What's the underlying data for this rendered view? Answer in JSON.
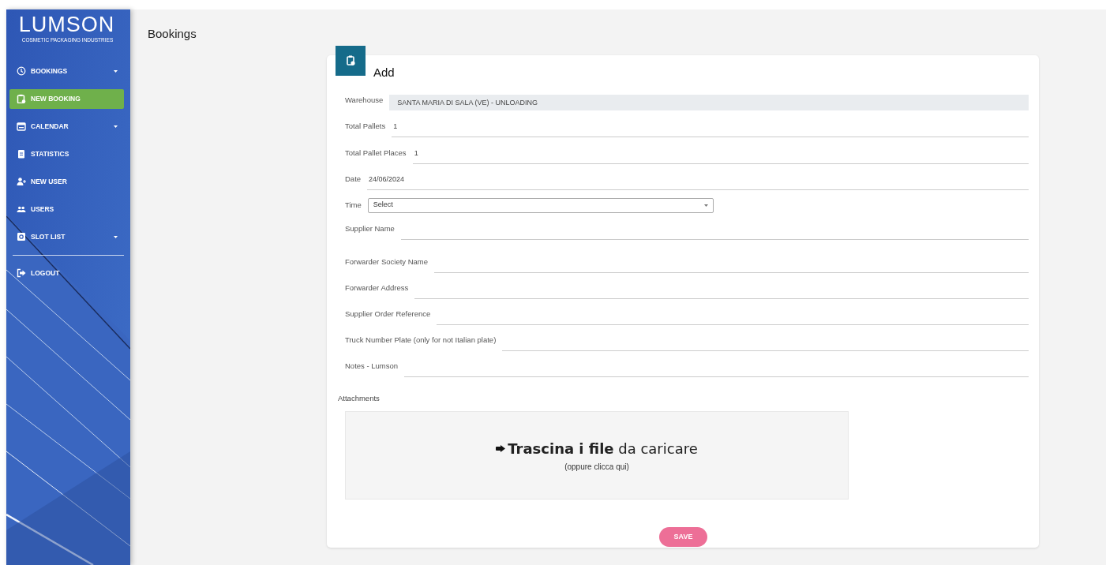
{
  "logo": {
    "name": "LUMSON",
    "tagline": "COSMETIC PACKAGING INDUSTRIES"
  },
  "sidebar": {
    "items": [
      {
        "label": "BOOKINGS",
        "selected": false,
        "expandable": true
      },
      {
        "label": "NEW BOOKING",
        "selected": true,
        "expandable": false
      },
      {
        "label": "CALENDAR",
        "selected": false,
        "expandable": true
      },
      {
        "label": "STATISTICS",
        "selected": false,
        "expandable": false
      },
      {
        "label": "NEW USER",
        "selected": false,
        "expandable": false
      },
      {
        "label": "USERS",
        "selected": false,
        "expandable": false
      },
      {
        "label": "SLOT LIST",
        "selected": false,
        "expandable": true
      }
    ],
    "footer_items": [
      {
        "label": "LOGOUT",
        "selected": false,
        "expandable": false
      }
    ]
  },
  "page_title": "Bookings",
  "form": {
    "title": "Add",
    "fields": [
      {
        "kind": "readonly",
        "label": "Warehouse",
        "value": "SANTA MARIA DI SALA (VE) - UNLOADING"
      },
      {
        "kind": "text",
        "label": "Total Pallets",
        "value": "1"
      },
      {
        "kind": "text",
        "label": "Total Pallet Places",
        "value": "1"
      },
      {
        "kind": "text",
        "label": "Date",
        "value": "24/06/2024"
      },
      {
        "kind": "select",
        "label": "Time",
        "value": "Select"
      },
      {
        "kind": "text",
        "label": "Supplier Name"
      },
      {
        "kind": "text",
        "label": "Forwarder Society Name"
      },
      {
        "kind": "text",
        "label": "Forwarder Address"
      },
      {
        "kind": "text",
        "label": "Supplier Order Reference"
      },
      {
        "kind": "text",
        "label": "Truck Number Plate (only for not Italian plate)"
      },
      {
        "kind": "text",
        "label": "Notes - Lumson"
      }
    ],
    "attachments": {
      "label": "Attachments",
      "drop_text": "**Trascina i file** da caricare",
      "drop_hint": "(oppure clicca qui)"
    },
    "save_button": "SAVE"
  }
}
